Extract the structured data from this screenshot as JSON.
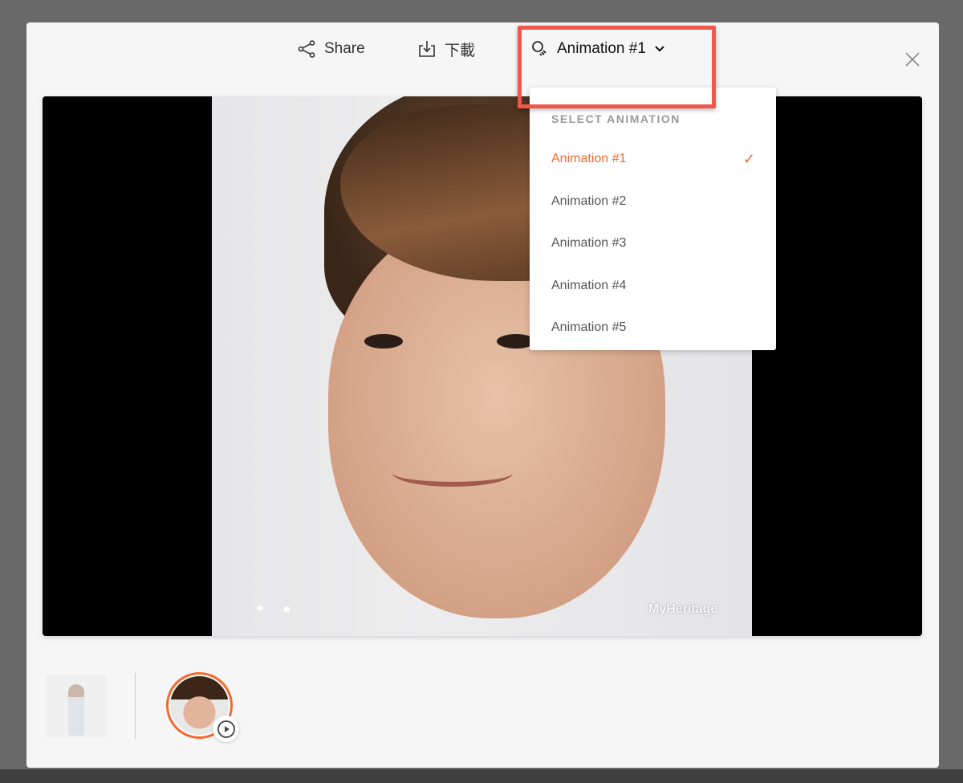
{
  "toolbar": {
    "share_label": "Share",
    "download_label": "下載",
    "animation_selected": "Animation #1"
  },
  "dropdown": {
    "header": "SELECT ANIMATION",
    "items": [
      {
        "label": "Animation #1",
        "selected": true
      },
      {
        "label": "Animation #2",
        "selected": false
      },
      {
        "label": "Animation #3",
        "selected": false
      },
      {
        "label": "Animation #4",
        "selected": false
      },
      {
        "label": "Animation #5",
        "selected": false
      }
    ]
  },
  "video": {
    "watermark": "MyHeritage"
  },
  "colors": {
    "accent": "#f26a2e",
    "highlight": "#f0584d"
  }
}
